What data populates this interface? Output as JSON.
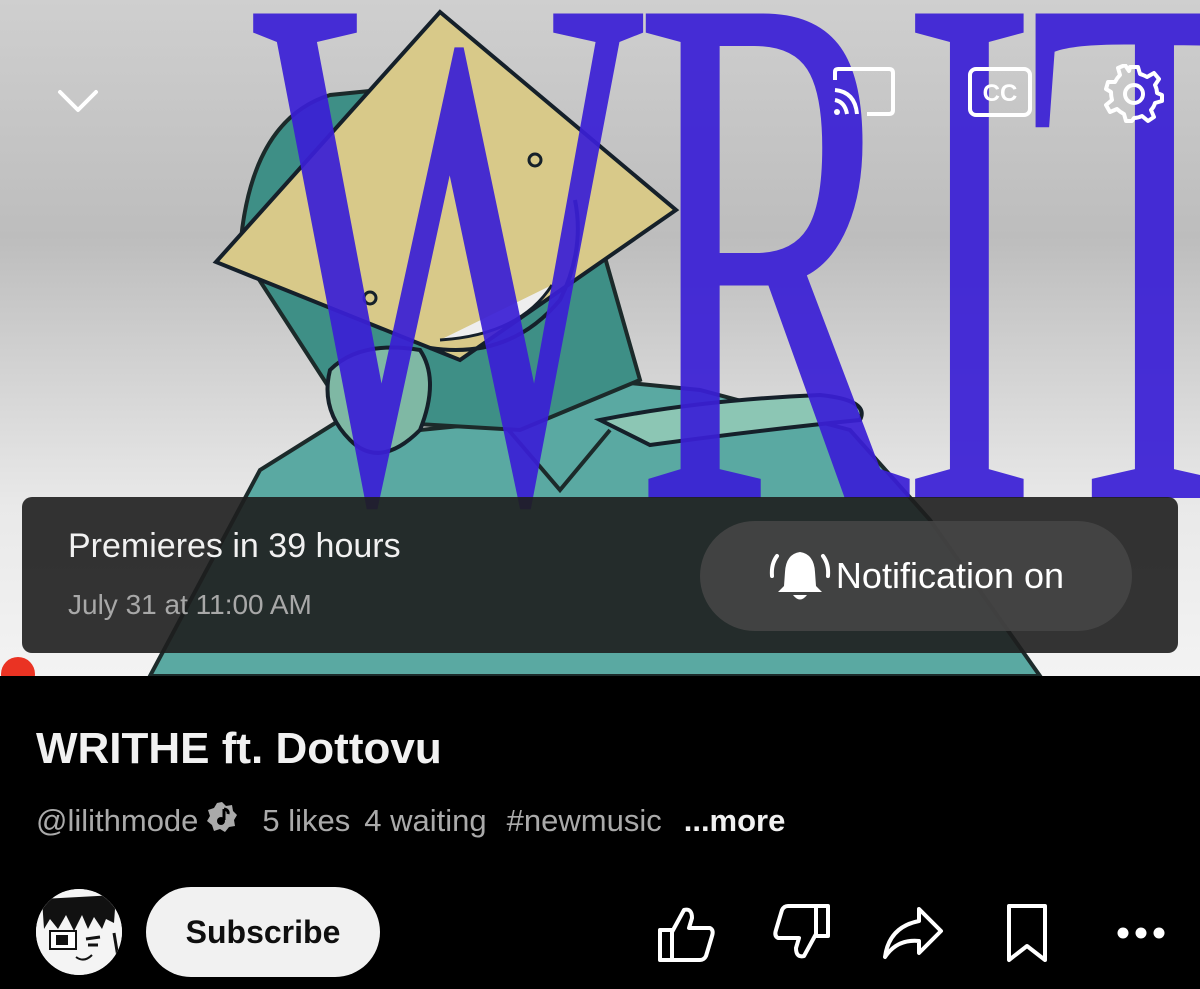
{
  "player": {
    "watermark_text": "WRITHE",
    "premiere": {
      "status": "Premieres in 39 hours",
      "scheduled": "July 31 at 11:00 AM",
      "notify_label": "Notification on"
    },
    "controls": {
      "collapse_icon": "chevron-down-icon",
      "cast_icon": "cast-icon",
      "cc_icon": "closed-captions-icon",
      "cc_text": "CC",
      "settings_icon": "gear-icon"
    },
    "progress": 0,
    "accent": "#ea3323"
  },
  "video": {
    "title": "WRITHE ft. Dottovu",
    "channel_handle": "@lilithmode",
    "likes": "5 likes",
    "waiting": "4 waiting",
    "hashtag": "#newmusic",
    "more": "...more"
  },
  "actions": {
    "subscribe": "Subscribe",
    "icons": [
      "thumbs-up-icon",
      "thumbs-down-icon",
      "share-icon",
      "bookmark-icon",
      "more-horizontal-icon"
    ]
  },
  "colors": {
    "background": "#000000",
    "watermark": "#3a1fd6",
    "text_primary": "#f1f1f1",
    "text_secondary": "#aaaaaa"
  }
}
